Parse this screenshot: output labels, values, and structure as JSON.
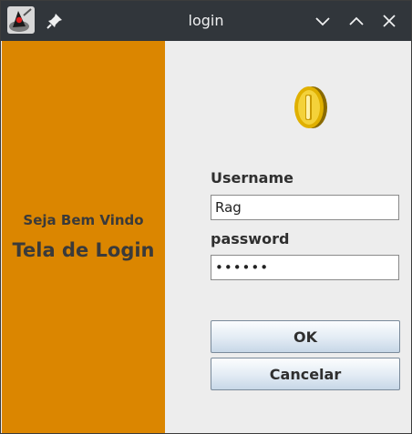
{
  "window": {
    "title": "login"
  },
  "titlebar_icons": [
    "java-duke-icon",
    "pin-icon",
    "minimize-icon",
    "maximize-icon",
    "close-icon"
  ],
  "sidebar": {
    "welcome": "Seja Bem Vindo",
    "screen_title": "Tela de Login",
    "background_color": "#db8600"
  },
  "form": {
    "logo_icon": "gold-coin-icon",
    "username_label": "Username",
    "username_value": "Rag",
    "password_label": "password",
    "password_value": "••••••",
    "ok_label": "OK",
    "cancel_label": "Cancelar"
  }
}
